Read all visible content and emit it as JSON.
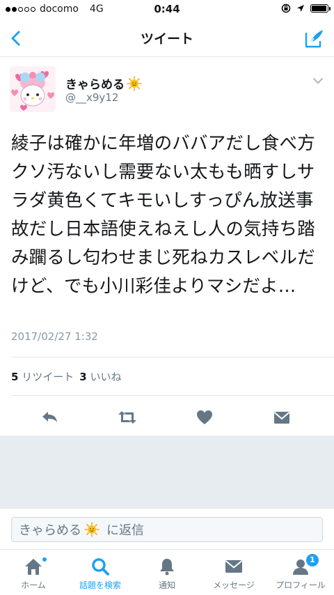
{
  "status_bar": {
    "carrier": "docomo",
    "network": "4G",
    "time": "0:44",
    "signal_bars_filled": 2,
    "signal_bars_total": 5,
    "battery_level": 0.95
  },
  "nav": {
    "title": "ツイート",
    "back_icon": "chevron-left-icon",
    "compose_icon": "compose-tweet-icon"
  },
  "tweet": {
    "user_name": "きゃらめる",
    "user_handle": "@__x9y12",
    "name_emoji": "sun-emoji",
    "text": "綾子は確かに年増のババアだし食べ方クソ汚ないし需要ない太もも晒すしサラダ黄色くてキモいしすっぴん放送事故だし日本語使えねえし人の気持ち踏み躙るし匂わせまじ死ねカスレベルだけど、でも小川彩佳よりマシだよ…",
    "timestamp": "2017/02/27 1:32",
    "retweet_count": "5",
    "retweet_label": "リツイート",
    "like_count": "3",
    "like_label": "いいね"
  },
  "reply": {
    "name": "きゃらめる",
    "suffix": "に返信"
  },
  "tabs": [
    {
      "label": "ホーム",
      "icon": "home-icon"
    },
    {
      "label": "話題を検索",
      "icon": "search-icon"
    },
    {
      "label": "通知",
      "icon": "bell-icon"
    },
    {
      "label": "メッセージ",
      "icon": "envelope-icon"
    },
    {
      "label": "プロフィール",
      "icon": "profile-icon",
      "badge": "1"
    }
  ],
  "colors": {
    "accent": "#1da1f2",
    "action_gray": "#657786",
    "divider": "#e1e8ed",
    "background_gray": "#e6ecf0"
  }
}
